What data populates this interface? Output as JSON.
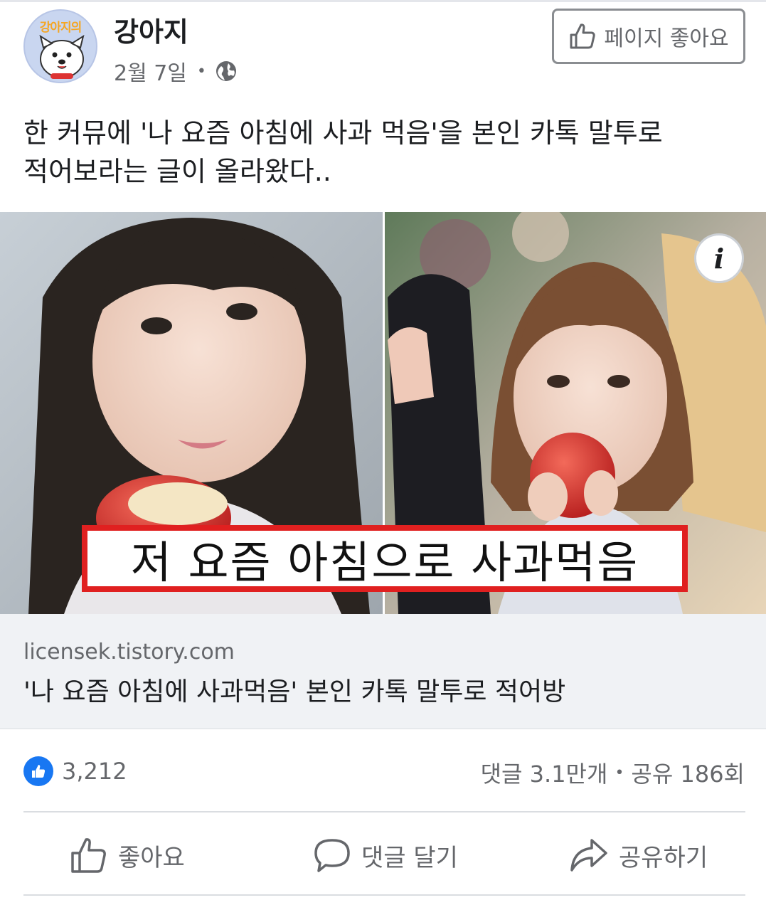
{
  "header": {
    "avatar_text": "강아지의",
    "page_name": "강아지",
    "date": "2월 7일",
    "separator": "•",
    "like_page_label": "페이지 좋아요"
  },
  "post": {
    "text_line1": "한 커뮤에 '나 요즘 아침에 사과 먹음'을 본인 카톡 말투로",
    "text_line2": "적어보라는 글이 올라왔다.."
  },
  "media": {
    "caption": "저 요즘 아침으로 사과먹음",
    "info_glyph": "i"
  },
  "link": {
    "domain": "licensek.tistory.com",
    "title": "'나 요즘 아침에 사과먹음' 본인 카톡 말투로 적어방"
  },
  "stats": {
    "likes": "3,212",
    "comments": "댓글 3.1만개",
    "separator": "•",
    "shares": "공유 186회"
  },
  "actions": {
    "like": "좋아요",
    "comment": "댓글 달기",
    "share": "공유하기"
  },
  "colors": {
    "accent": "#1877f2",
    "caption_border": "#e02020",
    "muted_text": "#65676b"
  }
}
